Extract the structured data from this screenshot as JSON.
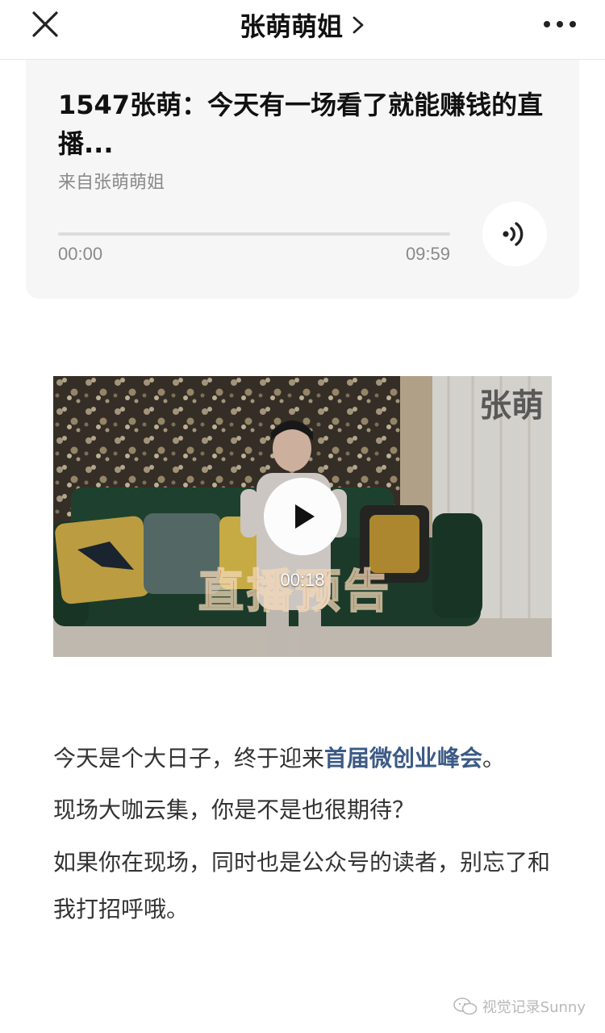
{
  "nav": {
    "title": "张萌萌姐",
    "close_icon": "close-icon",
    "more_icon": "more-icon"
  },
  "audio": {
    "title": "1547张萌：今天有一场看了就能赚钱的直播...",
    "source": "来自张萌萌姐",
    "current_time": "00:00",
    "total_time": "09:59",
    "progress": 0,
    "play_icon": "audio-wave-icon"
  },
  "video": {
    "duration": "00:18",
    "caption": "直播预告",
    "corner_brand": "张萌",
    "play_icon": "play-icon"
  },
  "article": {
    "p1_before": "今天是个大日子，终于迎来",
    "p1_link": "首届微创业峰会",
    "p1_after": "。",
    "p2": "现场大咖云集，你是不是也很期待？",
    "p3": "如果你在现场，同时也是公众号的读者，别忘了和我打招呼哦。"
  },
  "watermark": {
    "text": "视觉记录Sunny",
    "icon": "wechat-icon"
  },
  "colors": {
    "link": "#3c5a85",
    "card_bg": "#f6f6f6",
    "muted_text": "#8a8a8a"
  }
}
